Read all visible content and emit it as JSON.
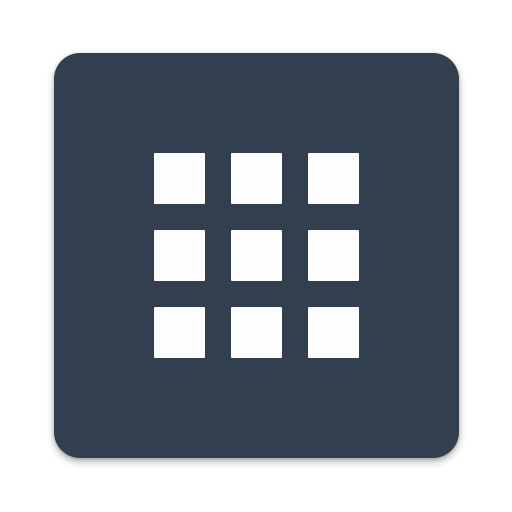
{
  "icon": {
    "name": "apps-grid-icon",
    "background_color": "#323f4e",
    "glyph_color": "#fdfdfd",
    "rows": 3,
    "columns": 3
  }
}
